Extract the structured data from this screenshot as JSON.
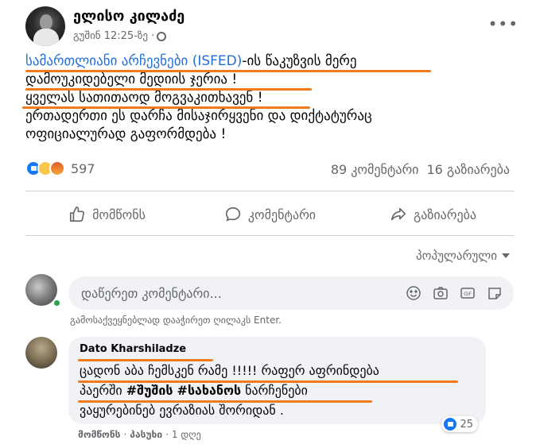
{
  "post": {
    "author": "ელისო კილაძე",
    "timestamp": "გუშინ 12:25-ზე ·",
    "more_icon": "more-horizontal-icon",
    "text_lines": [
      {
        "link": "სამართლიანი არჩევნები (ISFED)",
        "rest": "-ის წაკუზვის მერე"
      },
      "დამოუკიდებელი მედიის ჯერია !",
      "ყველას სათითაოდ მოგვაკითხავენ !",
      "ერთადერთი ეს დარჩა მისაჯირყვენი და დიქტატურაც",
      "ოფიციალურად გაფორმდება !"
    ],
    "reactions_count": "597",
    "comments_count": "89 კომენტარი",
    "shares_count": "16 გაზიარება"
  },
  "actions": {
    "like": "მომწონს",
    "comment": "კომენტარი",
    "share": "გაზიარება"
  },
  "sort": {
    "label": "პოპულარული"
  },
  "composer": {
    "placeholder": "დაწერეთ კომენტარი...",
    "hint": "გამოსაქვეყნებლად დააჭირეთ ღილაკს Enter.",
    "icons": [
      "emoji-icon",
      "camera-icon",
      "gif-icon",
      "sticker-icon"
    ]
  },
  "comment": {
    "author": "Dato Kharshiladze",
    "text_lines": [
      "ცადონ აბა ჩემსკენ რამე !!!!! რაფერ აფრინდება",
      {
        "pre": "პაერში ",
        "tag1": "#შუშის",
        "sep": " ",
        "tag2": "#სახანოს",
        "post": " ნარჩენები"
      },
      "ვაყურებინებ ევრაზიას შორიდან ."
    ],
    "reaction_count": "25",
    "like": "მომწონს",
    "reply": "პასუხი",
    "time": "1 დღე"
  },
  "colors": {
    "link": "#216fdb",
    "highlight_underline": "#f07a1e",
    "meta_gray": "#65676b"
  }
}
